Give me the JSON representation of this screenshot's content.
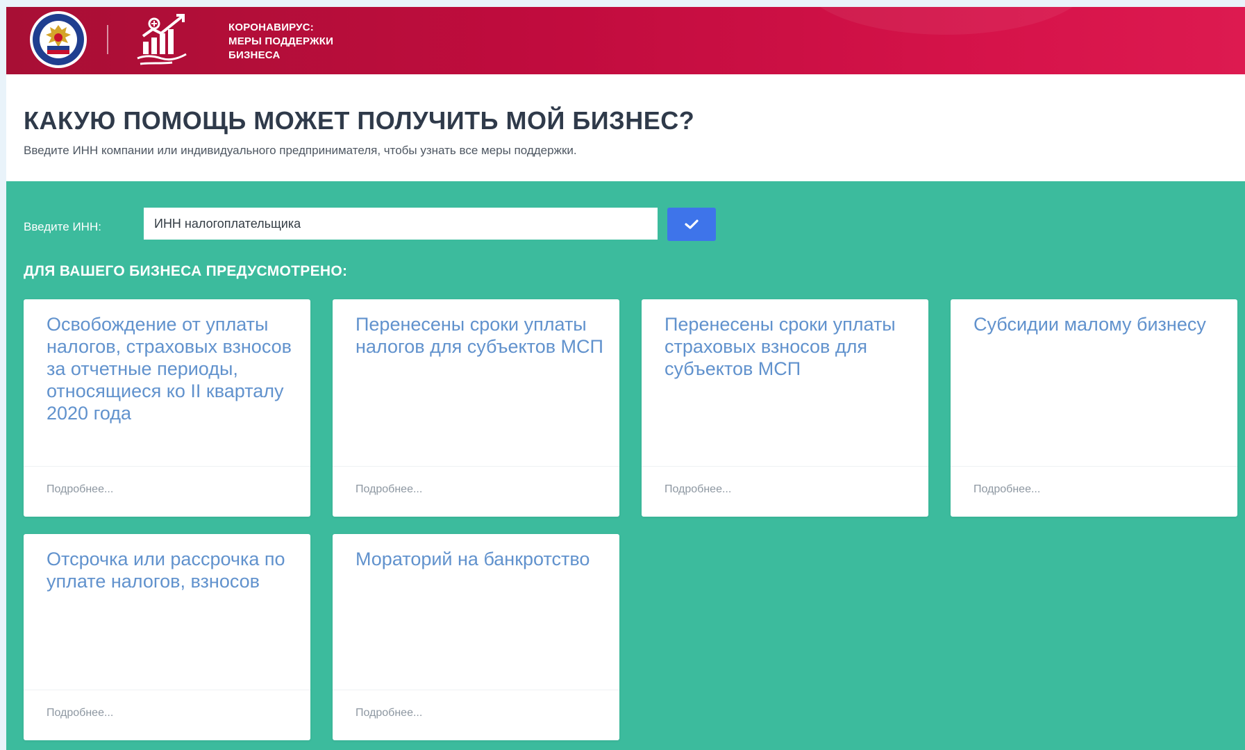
{
  "header": {
    "brand_lines": [
      "КОРОНАВИРУС:",
      "МЕРЫ ПОДДЕРЖКИ",
      "БИЗНЕСА"
    ],
    "emblem_icon": "fns-emblem-icon",
    "logo_icon": "business-growth-icon",
    "brand_color": "#c10c3e"
  },
  "intro": {
    "title": "КАКУЮ ПОМОЩЬ МОЖЕТ ПОЛУЧИТЬ МОЙ БИЗНЕС?",
    "subtitle": "Введите ИНН компании или индивидуального предпринимателя, чтобы узнать все меры поддержки."
  },
  "search": {
    "label": "Введите ИНН:",
    "placeholder": "ИНН налогоплательщика",
    "value": "",
    "submit_icon": "checkmark-icon",
    "button_color": "#3e74ea"
  },
  "section": {
    "title": "ДЛЯ ВАШЕГО БИЗНЕСА ПРЕДУСМОТРЕНО:",
    "background_color": "#3cbb9d"
  },
  "cards": [
    {
      "title": "Освобождение от уплаты налогов, страховых взносов за отчетные периоды, относящиеся ко II кварталу 2020 года",
      "link": "Подробнее..."
    },
    {
      "title": "Перенесены сроки уплаты налогов для субъектов МСП",
      "link": "Подробнее..."
    },
    {
      "title": "Перенесены сроки уплаты страховых взносов для субъектов МСП",
      "link": "Подробнее..."
    },
    {
      "title": "Субсидии малому бизнесу",
      "link": "Подробнее..."
    },
    {
      "title": "Отсрочка или рассрочка по уплате налогов, взносов",
      "link": "Подробнее..."
    },
    {
      "title": "Мораторий на банкротство",
      "link": "Подробнее..."
    }
  ]
}
